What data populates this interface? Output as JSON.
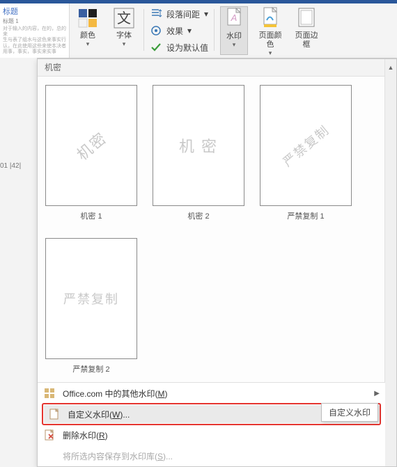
{
  "ribbon": {
    "style_title": "标题",
    "style_sub1": "标题 1",
    "colors_label": "颜色",
    "fonts_label": "字体",
    "spacing_label": "段落间距",
    "effects_label": "效果",
    "set_default_label": "设为默认值",
    "watermark_label": "水印",
    "page_color_label": "页面颜色",
    "page_border_label": "页面边框"
  },
  "ruler": {
    "marks": "01  |42|"
  },
  "panel": {
    "section_title": "机密",
    "scroll_up": "▲",
    "items": [
      {
        "watermark": "机密",
        "diagonal": true,
        "caption": "机密 1"
      },
      {
        "watermark": "机 密",
        "diagonal": false,
        "caption": "机密 2"
      },
      {
        "watermark": "严禁复制",
        "diagonal": true,
        "caption": "严禁复制 1"
      },
      {
        "watermark": "严禁复制",
        "diagonal": false,
        "caption": "严禁复制 2"
      }
    ],
    "menu": {
      "more_office": {
        "text": "Office.com 中的其他水印(",
        "hotkey": "M",
        "suffix": ")"
      },
      "custom": {
        "text": "自定义水印(",
        "hotkey": "W",
        "suffix": ")..."
      },
      "remove": {
        "text": "删除水印(",
        "hotkey": "R",
        "suffix": ")"
      },
      "save": {
        "text": "将所选内容保存到水印库(",
        "hotkey": "S",
        "suffix": ")..."
      }
    },
    "tooltip": "自定义水印"
  }
}
